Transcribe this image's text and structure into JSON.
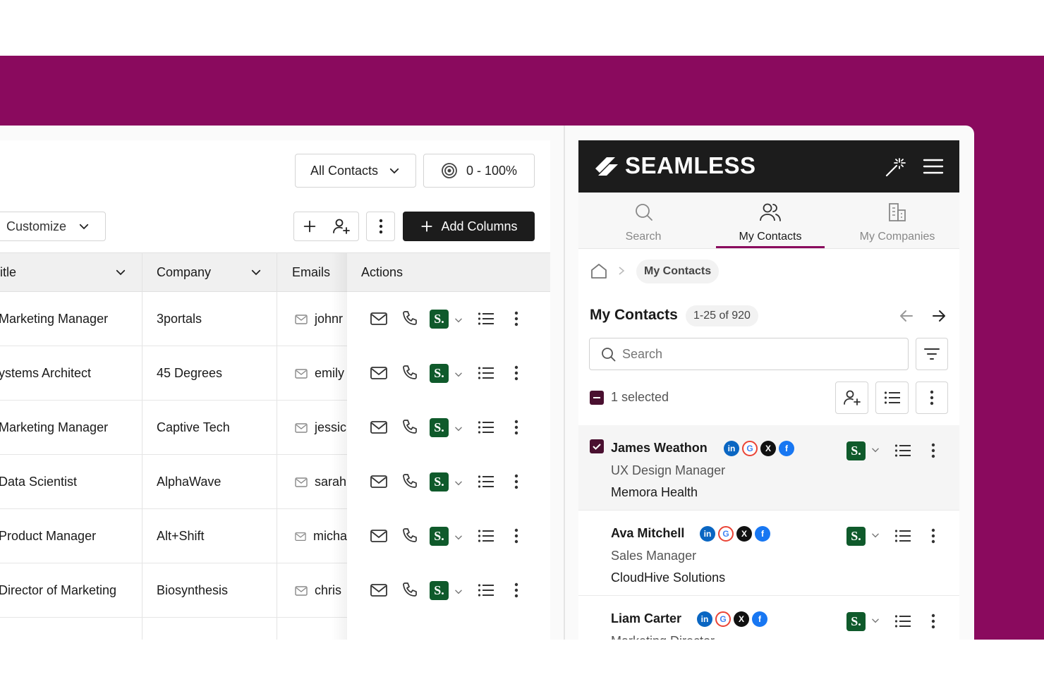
{
  "colors": {
    "brand_bg": "#8a0a5e",
    "seamless_green": "#0f5a2b",
    "header_dark": "#1c1c1c",
    "tab_active": "#8a0a5e"
  },
  "toolbar": {
    "filter_dropdown": "All Contacts",
    "score_range": "0 - 100%",
    "customize": "Customize",
    "add_columns": "Add Columns"
  },
  "table": {
    "columns": [
      "itle",
      "Company",
      "Emails",
      "Actions"
    ],
    "rows": [
      {
        "title": "Marketing Manager",
        "company": "3portals",
        "email": "johnr"
      },
      {
        "title": "ystems Architect",
        "company": "45 Degrees",
        "email": "emily"
      },
      {
        "title": "Marketing Manager",
        "company": "Captive Tech",
        "email": "jessic"
      },
      {
        "title": "Data Scientist",
        "company": "AlphaWave",
        "email": "sarah"
      },
      {
        "title": "Product Manager",
        "company": "Alt+Shift",
        "email": "micha"
      },
      {
        "title": "Director of Marketing",
        "company": "Biosynthesis",
        "email": "chris"
      }
    ],
    "seamless_badge": "S."
  },
  "panel": {
    "logo": "SEAMLESS",
    "tabs": [
      {
        "label": "Search",
        "icon": "search-icon"
      },
      {
        "label": "My Contacts",
        "icon": "contacts-icon"
      },
      {
        "label": "My Companies",
        "icon": "building-icon"
      }
    ],
    "breadcrumb_current": "My Contacts",
    "title": "My Contacts",
    "count": "1-25 of 920",
    "search_placeholder": "Search",
    "selected_text": "1 selected",
    "contacts": [
      {
        "name": "James Weathon",
        "title": "UX Design Manager",
        "company": "Memora Health",
        "selected": true
      },
      {
        "name": "Ava Mitchell",
        "title": "Sales Manager",
        "company": "CloudHive Solutions",
        "selected": false
      },
      {
        "name": "Liam Carter",
        "title": "Marketing Director",
        "company": "",
        "selected": false
      }
    ]
  }
}
